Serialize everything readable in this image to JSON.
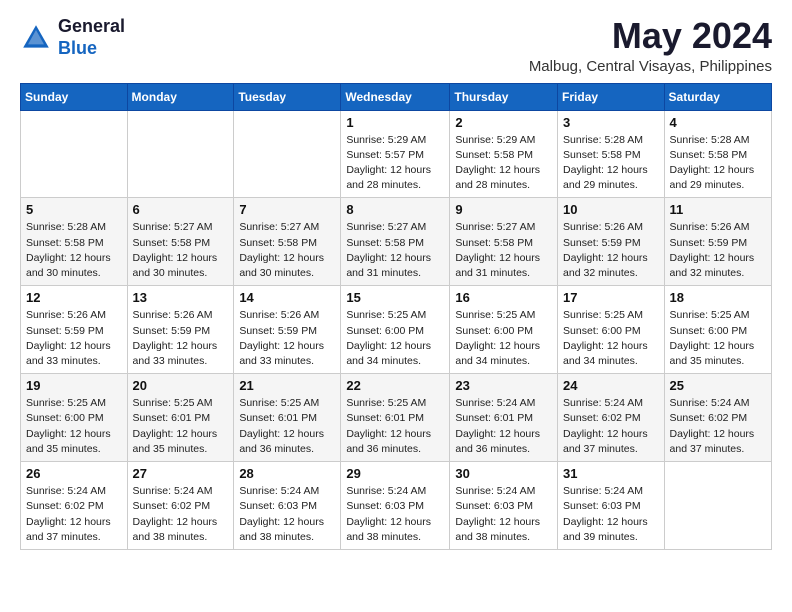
{
  "logo": {
    "general": "General",
    "blue": "Blue"
  },
  "title": "May 2024",
  "subtitle": "Malbug, Central Visayas, Philippines",
  "days": [
    "Sunday",
    "Monday",
    "Tuesday",
    "Wednesday",
    "Thursday",
    "Friday",
    "Saturday"
  ],
  "weeks": [
    [
      {
        "date": "",
        "sunrise": "",
        "sunset": "",
        "daylight": ""
      },
      {
        "date": "",
        "sunrise": "",
        "sunset": "",
        "daylight": ""
      },
      {
        "date": "",
        "sunrise": "",
        "sunset": "",
        "daylight": ""
      },
      {
        "date": "1",
        "sunrise": "Sunrise: 5:29 AM",
        "sunset": "Sunset: 5:57 PM",
        "daylight": "Daylight: 12 hours and 28 minutes."
      },
      {
        "date": "2",
        "sunrise": "Sunrise: 5:29 AM",
        "sunset": "Sunset: 5:58 PM",
        "daylight": "Daylight: 12 hours and 28 minutes."
      },
      {
        "date": "3",
        "sunrise": "Sunrise: 5:28 AM",
        "sunset": "Sunset: 5:58 PM",
        "daylight": "Daylight: 12 hours and 29 minutes."
      },
      {
        "date": "4",
        "sunrise": "Sunrise: 5:28 AM",
        "sunset": "Sunset: 5:58 PM",
        "daylight": "Daylight: 12 hours and 29 minutes."
      }
    ],
    [
      {
        "date": "5",
        "sunrise": "Sunrise: 5:28 AM",
        "sunset": "Sunset: 5:58 PM",
        "daylight": "Daylight: 12 hours and 30 minutes."
      },
      {
        "date": "6",
        "sunrise": "Sunrise: 5:27 AM",
        "sunset": "Sunset: 5:58 PM",
        "daylight": "Daylight: 12 hours and 30 minutes."
      },
      {
        "date": "7",
        "sunrise": "Sunrise: 5:27 AM",
        "sunset": "Sunset: 5:58 PM",
        "daylight": "Daylight: 12 hours and 30 minutes."
      },
      {
        "date": "8",
        "sunrise": "Sunrise: 5:27 AM",
        "sunset": "Sunset: 5:58 PM",
        "daylight": "Daylight: 12 hours and 31 minutes."
      },
      {
        "date": "9",
        "sunrise": "Sunrise: 5:27 AM",
        "sunset": "Sunset: 5:58 PM",
        "daylight": "Daylight: 12 hours and 31 minutes."
      },
      {
        "date": "10",
        "sunrise": "Sunrise: 5:26 AM",
        "sunset": "Sunset: 5:59 PM",
        "daylight": "Daylight: 12 hours and 32 minutes."
      },
      {
        "date": "11",
        "sunrise": "Sunrise: 5:26 AM",
        "sunset": "Sunset: 5:59 PM",
        "daylight": "Daylight: 12 hours and 32 minutes."
      }
    ],
    [
      {
        "date": "12",
        "sunrise": "Sunrise: 5:26 AM",
        "sunset": "Sunset: 5:59 PM",
        "daylight": "Daylight: 12 hours and 33 minutes."
      },
      {
        "date": "13",
        "sunrise": "Sunrise: 5:26 AM",
        "sunset": "Sunset: 5:59 PM",
        "daylight": "Daylight: 12 hours and 33 minutes."
      },
      {
        "date": "14",
        "sunrise": "Sunrise: 5:26 AM",
        "sunset": "Sunset: 5:59 PM",
        "daylight": "Daylight: 12 hours and 33 minutes."
      },
      {
        "date": "15",
        "sunrise": "Sunrise: 5:25 AM",
        "sunset": "Sunset: 6:00 PM",
        "daylight": "Daylight: 12 hours and 34 minutes."
      },
      {
        "date": "16",
        "sunrise": "Sunrise: 5:25 AM",
        "sunset": "Sunset: 6:00 PM",
        "daylight": "Daylight: 12 hours and 34 minutes."
      },
      {
        "date": "17",
        "sunrise": "Sunrise: 5:25 AM",
        "sunset": "Sunset: 6:00 PM",
        "daylight": "Daylight: 12 hours and 34 minutes."
      },
      {
        "date": "18",
        "sunrise": "Sunrise: 5:25 AM",
        "sunset": "Sunset: 6:00 PM",
        "daylight": "Daylight: 12 hours and 35 minutes."
      }
    ],
    [
      {
        "date": "19",
        "sunrise": "Sunrise: 5:25 AM",
        "sunset": "Sunset: 6:00 PM",
        "daylight": "Daylight: 12 hours and 35 minutes."
      },
      {
        "date": "20",
        "sunrise": "Sunrise: 5:25 AM",
        "sunset": "Sunset: 6:01 PM",
        "daylight": "Daylight: 12 hours and 35 minutes."
      },
      {
        "date": "21",
        "sunrise": "Sunrise: 5:25 AM",
        "sunset": "Sunset: 6:01 PM",
        "daylight": "Daylight: 12 hours and 36 minutes."
      },
      {
        "date": "22",
        "sunrise": "Sunrise: 5:25 AM",
        "sunset": "Sunset: 6:01 PM",
        "daylight": "Daylight: 12 hours and 36 minutes."
      },
      {
        "date": "23",
        "sunrise": "Sunrise: 5:24 AM",
        "sunset": "Sunset: 6:01 PM",
        "daylight": "Daylight: 12 hours and 36 minutes."
      },
      {
        "date": "24",
        "sunrise": "Sunrise: 5:24 AM",
        "sunset": "Sunset: 6:02 PM",
        "daylight": "Daylight: 12 hours and 37 minutes."
      },
      {
        "date": "25",
        "sunrise": "Sunrise: 5:24 AM",
        "sunset": "Sunset: 6:02 PM",
        "daylight": "Daylight: 12 hours and 37 minutes."
      }
    ],
    [
      {
        "date": "26",
        "sunrise": "Sunrise: 5:24 AM",
        "sunset": "Sunset: 6:02 PM",
        "daylight": "Daylight: 12 hours and 37 minutes."
      },
      {
        "date": "27",
        "sunrise": "Sunrise: 5:24 AM",
        "sunset": "Sunset: 6:02 PM",
        "daylight": "Daylight: 12 hours and 38 minutes."
      },
      {
        "date": "28",
        "sunrise": "Sunrise: 5:24 AM",
        "sunset": "Sunset: 6:03 PM",
        "daylight": "Daylight: 12 hours and 38 minutes."
      },
      {
        "date": "29",
        "sunrise": "Sunrise: 5:24 AM",
        "sunset": "Sunset: 6:03 PM",
        "daylight": "Daylight: 12 hours and 38 minutes."
      },
      {
        "date": "30",
        "sunrise": "Sunrise: 5:24 AM",
        "sunset": "Sunset: 6:03 PM",
        "daylight": "Daylight: 12 hours and 38 minutes."
      },
      {
        "date": "31",
        "sunrise": "Sunrise: 5:24 AM",
        "sunset": "Sunset: 6:03 PM",
        "daylight": "Daylight: 12 hours and 39 minutes."
      },
      {
        "date": "",
        "sunrise": "",
        "sunset": "",
        "daylight": ""
      }
    ]
  ]
}
